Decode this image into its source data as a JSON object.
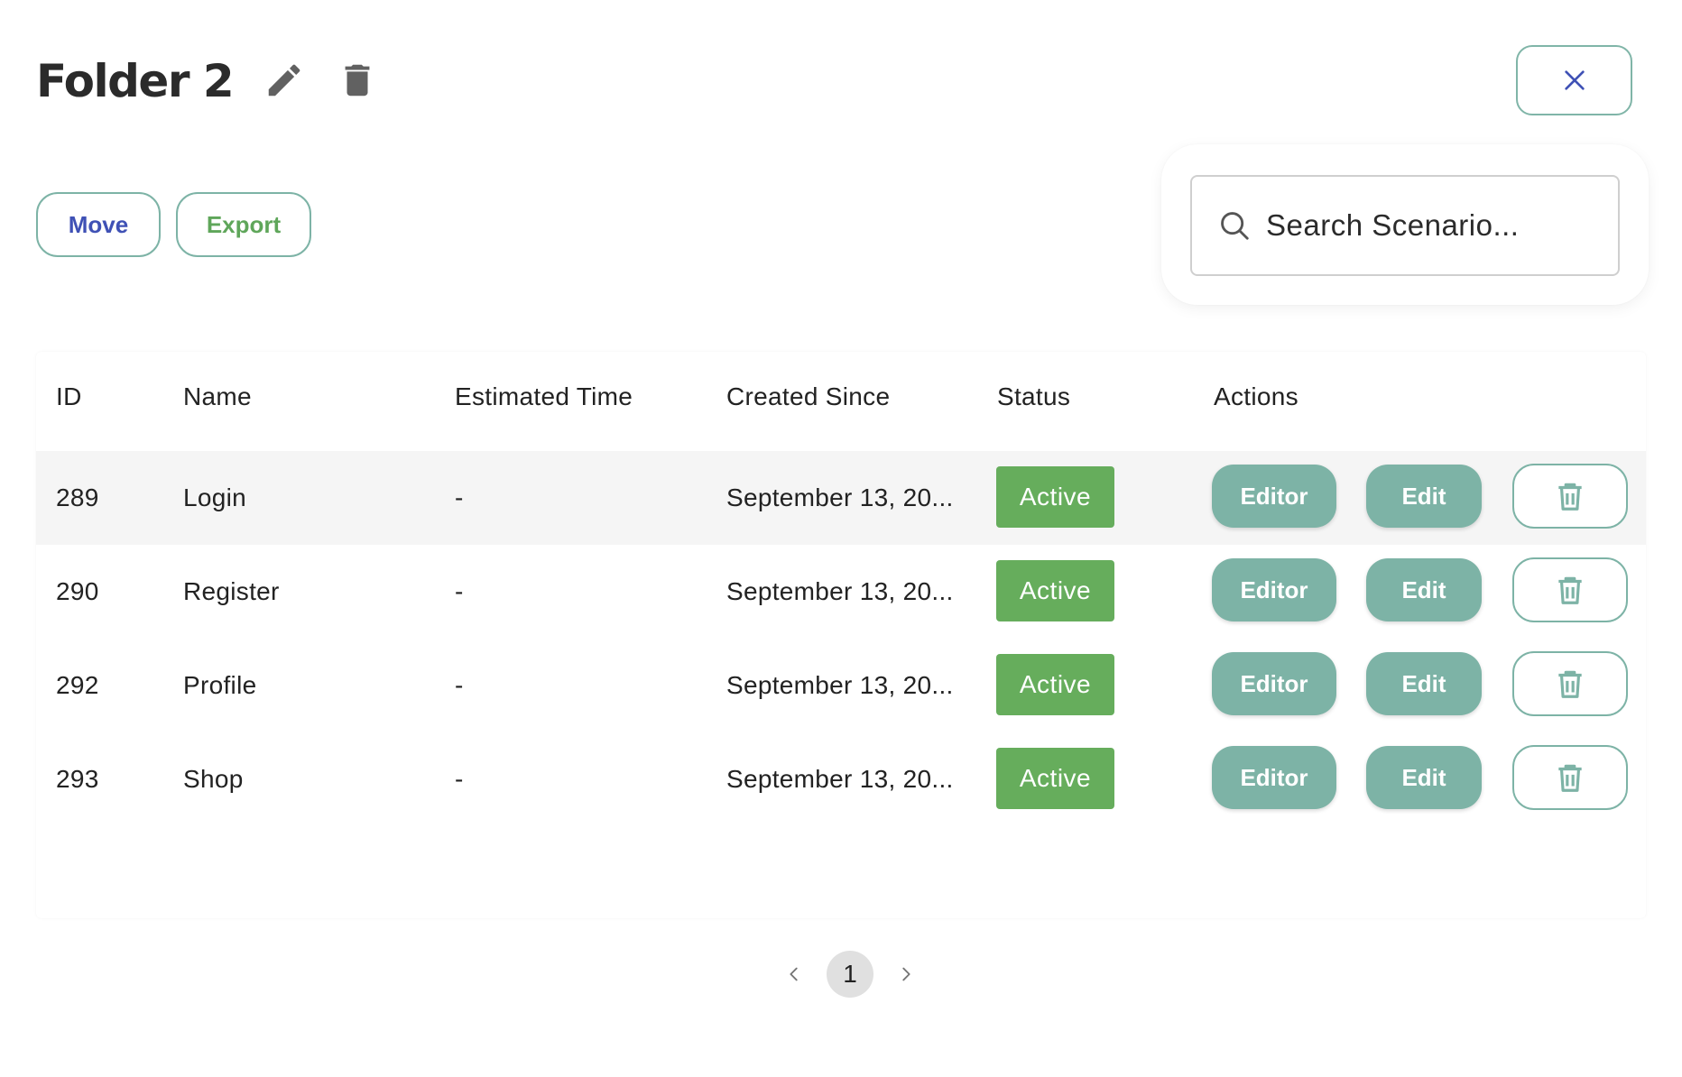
{
  "header": {
    "title": "Folder 2",
    "icons": [
      "pencil-icon",
      "trash-icon",
      "close-icon"
    ]
  },
  "toolbar": {
    "move_label": "Move",
    "export_label": "Export"
  },
  "search": {
    "placeholder": "Search Scenario..."
  },
  "table": {
    "columns": [
      "ID",
      "Name",
      "Estimated Time",
      "Created Since",
      "Status",
      "Actions"
    ],
    "rows": [
      {
        "id": "289",
        "name": "Login",
        "estimated_time": "-",
        "created_since": "September 13, 20...",
        "status": "Active"
      },
      {
        "id": "290",
        "name": "Register",
        "estimated_time": "-",
        "created_since": "September 13, 20...",
        "status": "Active"
      },
      {
        "id": "292",
        "name": "Profile",
        "estimated_time": "-",
        "created_since": "September 13, 20...",
        "status": "Active"
      },
      {
        "id": "293",
        "name": "Shop",
        "estimated_time": "-",
        "created_since": "September 13, 20...",
        "status": "Active"
      }
    ],
    "actions": {
      "editor_label": "Editor",
      "edit_label": "Edit"
    }
  },
  "pagination": {
    "current_page": "1"
  },
  "colors": {
    "accent_teal": "#7db3a6",
    "status_active": "#66ad5c",
    "move_text": "#3f51b5",
    "export_text": "#5fa65a"
  }
}
